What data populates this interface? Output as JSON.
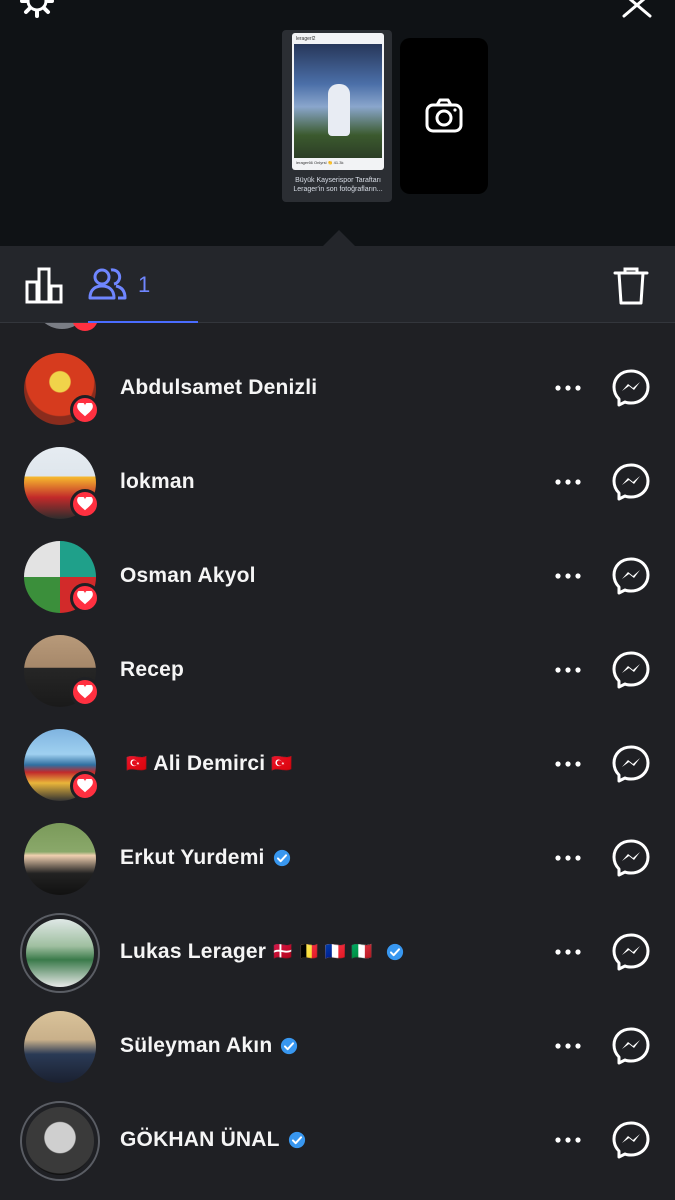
{
  "header": {
    "thumbnail": {
      "username": "leragerl2",
      "caption": "lerager66 Onlyrsl 👏 41.3k",
      "story_text": "Büyük Kayserispor Taraftarı Lerager'in son fotoğrafların..."
    }
  },
  "tabs": {
    "viewers_count": "1"
  },
  "viewers": [
    {
      "name": "Abdulsamet Denizli",
      "liked": true,
      "verified": false,
      "flags_before": "",
      "flags_after": ""
    },
    {
      "name": "lokman",
      "liked": true,
      "verified": false,
      "flags_before": "",
      "flags_after": ""
    },
    {
      "name": "Osman Akyol",
      "liked": true,
      "verified": false,
      "flags_before": "",
      "flags_after": ""
    },
    {
      "name": "Recep",
      "liked": true,
      "verified": false,
      "flags_before": "",
      "flags_after": ""
    },
    {
      "name": "Ali Demirci",
      "liked": true,
      "verified": false,
      "flags_before": "🇹🇷",
      "flags_after": "🇹🇷"
    },
    {
      "name": "Erkut Yurdemi",
      "liked": false,
      "verified": true,
      "flags_before": "",
      "flags_after": ""
    },
    {
      "name": "Lukas Lerager",
      "liked": false,
      "verified": true,
      "flags_before": "",
      "flags_after": "🇩🇰 🇧🇪 🇫🇷 🇮🇹"
    },
    {
      "name": "Süleyman Akın",
      "liked": false,
      "verified": true,
      "flags_before": "",
      "flags_after": ""
    },
    {
      "name": "GÖKHAN ÜNAL",
      "liked": false,
      "verified": true,
      "flags_before": "",
      "flags_after": ""
    }
  ],
  "colors": {
    "like_red": "#ff3040",
    "verified_blue": "#3897f0",
    "accent_blue": "#4a6cff",
    "background": "#1f2024"
  }
}
